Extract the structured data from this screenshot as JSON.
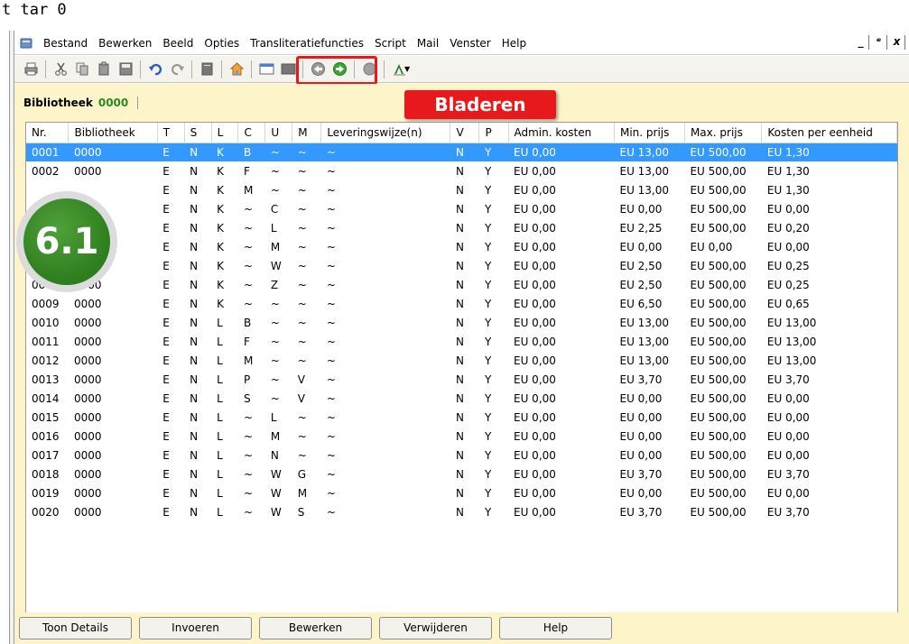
{
  "top_text": "t tar 0",
  "menu": {
    "items": [
      "Bestand",
      "Bewerken",
      "Beeld",
      "Opties",
      "Transliteratiefuncties",
      "Script",
      "Mail",
      "Venster",
      "Help"
    ],
    "window_controls": [
      "_",
      "ᵉ",
      "x"
    ]
  },
  "toolbar": {
    "icons": [
      "printer-icon",
      "cut-icon",
      "copy-icon",
      "paste-icon",
      "save-icon",
      "undo-icon",
      "redo-icon",
      "document-icon",
      "home-icon",
      "window-icon",
      "window-dark-icon",
      "back-arrow-icon",
      "forward-arrow-icon",
      "stop-icon",
      "font-icon"
    ]
  },
  "callout": {
    "label": "Bladeren"
  },
  "header": {
    "title": "Bibliotheek",
    "code": "0000"
  },
  "badge": {
    "label": "6.1"
  },
  "table": {
    "columns": [
      "Nr.",
      "Bibliotheek",
      "T",
      "S",
      "L",
      "C",
      "U",
      "M",
      "Leveringswijze(n)",
      "V",
      "P",
      "Admin. kosten",
      "Min. prijs",
      "Max. prijs",
      "Kosten per eenheid"
    ],
    "rows": [
      [
        "0001",
        "0000",
        "E",
        "N",
        "K",
        "B",
        "~",
        "~",
        "~",
        "N",
        "Y",
        "EU 0,00",
        "EU 13,00",
        "EU 500,00",
        "EU 1,30"
      ],
      [
        "0002",
        "0000",
        "E",
        "N",
        "K",
        "F",
        "~",
        "~",
        "~",
        "N",
        "Y",
        "EU 0,00",
        "EU 13,00",
        "EU 500,00",
        "EU 1,30"
      ],
      [
        "",
        "",
        "E",
        "N",
        "K",
        "M",
        "~",
        "~",
        "~",
        "N",
        "Y",
        "EU 0,00",
        "EU 13,00",
        "EU 500,00",
        "EU 1,30"
      ],
      [
        "",
        "",
        "E",
        "N",
        "K",
        "~",
        "C",
        "~",
        "~",
        "N",
        "Y",
        "EU 0,00",
        "EU 0,00",
        "EU 500,00",
        "EU 0,00"
      ],
      [
        "",
        "",
        "E",
        "N",
        "K",
        "~",
        "L",
        "~",
        "~",
        "N",
        "Y",
        "EU 0,00",
        "EU 2,25",
        "EU 500,00",
        "EU 0,20"
      ],
      [
        "",
        "",
        "E",
        "N",
        "K",
        "~",
        "M",
        "~",
        "~",
        "N",
        "Y",
        "EU 0,00",
        "EU 0,00",
        "EU 0,00",
        "EU 0,00"
      ],
      [
        "",
        "",
        "E",
        "N",
        "K",
        "~",
        "W",
        "~",
        "~",
        "N",
        "Y",
        "EU 0,00",
        "EU 2,50",
        "EU 500,00",
        "EU 0,25"
      ],
      [
        "0008",
        "0000",
        "E",
        "N",
        "K",
        "~",
        "Z",
        "~",
        "~",
        "N",
        "Y",
        "EU 0,00",
        "EU 2,50",
        "EU 500,00",
        "EU 0,25"
      ],
      [
        "0009",
        "0000",
        "E",
        "N",
        "K",
        "~",
        "~",
        "~",
        "~",
        "N",
        "Y",
        "EU 0,00",
        "EU 6,50",
        "EU 500,00",
        "EU 0,65"
      ],
      [
        "0010",
        "0000",
        "E",
        "N",
        "L",
        "B",
        "~",
        "~",
        "~",
        "N",
        "Y",
        "EU 0,00",
        "EU 13,00",
        "EU 500,00",
        "EU 13,00"
      ],
      [
        "0011",
        "0000",
        "E",
        "N",
        "L",
        "F",
        "~",
        "~",
        "~",
        "N",
        "Y",
        "EU 0,00",
        "EU 13,00",
        "EU 500,00",
        "EU 13,00"
      ],
      [
        "0012",
        "0000",
        "E",
        "N",
        "L",
        "M",
        "~",
        "~",
        "~",
        "N",
        "Y",
        "EU 0,00",
        "EU 13,00",
        "EU 500,00",
        "EU 13,00"
      ],
      [
        "0013",
        "0000",
        "E",
        "N",
        "L",
        "P",
        "~",
        "V",
        "~",
        "N",
        "Y",
        "EU 0,00",
        "EU 3,70",
        "EU 500,00",
        "EU 3,70"
      ],
      [
        "0014",
        "0000",
        "E",
        "N",
        "L",
        "S",
        "~",
        "V",
        "~",
        "N",
        "Y",
        "EU 0,00",
        "EU 0,00",
        "EU 500,00",
        "EU 0,00"
      ],
      [
        "0015",
        "0000",
        "E",
        "N",
        "L",
        "~",
        "L",
        "~",
        "~",
        "N",
        "Y",
        "EU 0,00",
        "EU 0,00",
        "EU 500,00",
        "EU 0,00"
      ],
      [
        "0016",
        "0000",
        "E",
        "N",
        "L",
        "~",
        "M",
        "~",
        "~",
        "N",
        "Y",
        "EU 0,00",
        "EU 0,00",
        "EU 500,00",
        "EU 0,00"
      ],
      [
        "0017",
        "0000",
        "E",
        "N",
        "L",
        "~",
        "N",
        "~",
        "~",
        "N",
        "Y",
        "EU 0,00",
        "EU 0,00",
        "EU 500,00",
        "EU 0,00"
      ],
      [
        "0018",
        "0000",
        "E",
        "N",
        "L",
        "~",
        "W",
        "G",
        "~",
        "N",
        "Y",
        "EU 0,00",
        "EU 3,70",
        "EU 500,00",
        "EU 3,70"
      ],
      [
        "0019",
        "0000",
        "E",
        "N",
        "L",
        "~",
        "W",
        "M",
        "~",
        "N",
        "Y",
        "EU 0,00",
        "EU 0,00",
        "EU 500,00",
        "EU 0,00"
      ],
      [
        "0020",
        "0000",
        "E",
        "N",
        "L",
        "~",
        "W",
        "S",
        "~",
        "N",
        "Y",
        "EU 0,00",
        "EU 3,70",
        "EU 500,00",
        "EU 3,70"
      ]
    ]
  },
  "buttons": [
    "Toon Details",
    "Invoeren",
    "Bewerken",
    "Verwijderen",
    "Help"
  ],
  "colors": {
    "accent_red": "#e8191d",
    "selection_blue": "#3399ff",
    "panel_yellow": "#fdf4c9",
    "badge_green": "#2e7d1e",
    "code_green": "#2a8a24"
  }
}
